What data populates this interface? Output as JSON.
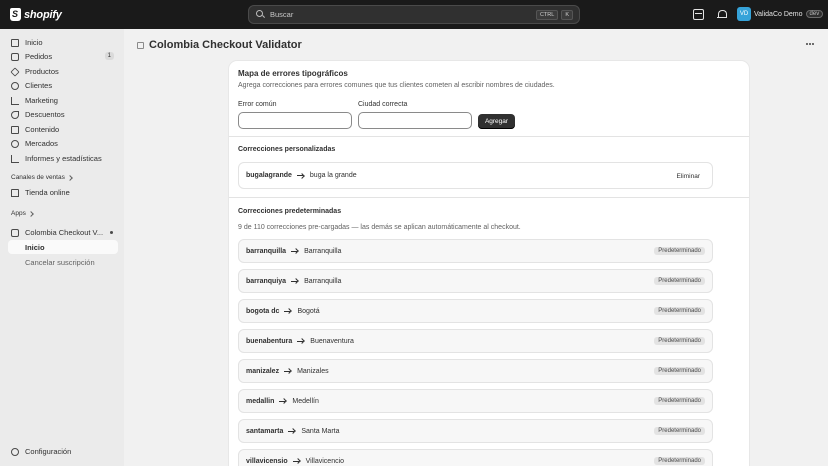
{
  "topbar": {
    "logo_text": "shopify",
    "search_placeholder": "Buscar",
    "shortcut_keys": [
      "CTRL",
      "K"
    ],
    "account_initials": "VD",
    "account_name": "ValidaCo Demo",
    "account_badge": "dev"
  },
  "sidebar": {
    "items": [
      {
        "label": "Inicio",
        "icon": "home-icon"
      },
      {
        "label": "Pedidos",
        "icon": "orders-icon",
        "count": "1"
      },
      {
        "label": "Productos",
        "icon": "tag-icon"
      },
      {
        "label": "Clientes",
        "icon": "person-icon"
      },
      {
        "label": "Marketing",
        "icon": "target-icon"
      },
      {
        "label": "Descuentos",
        "icon": "discount-icon"
      },
      {
        "label": "Contenido",
        "icon": "content-icon"
      },
      {
        "label": "Mercados",
        "icon": "globe-icon"
      },
      {
        "label": "Informes y estadísticas",
        "icon": "chart-icon"
      }
    ],
    "sales_channels_label": "Canales de ventas",
    "online_store_label": "Tienda online",
    "apps_label": "Apps",
    "app_name": "Colombia Checkout V...",
    "app_sub_home": "Inicio",
    "app_sub_cancel": "Cancelar suscripción",
    "settings_label": "Configuración"
  },
  "page": {
    "title": "Colombia Checkout Validator"
  },
  "card": {
    "title": "Mapa de errores tipográficos",
    "subtitle": "Agrega correcciones para errores comunes que tus clientes cometen al escribir nombres de ciudades.",
    "error_label": "Error común",
    "error_value": "",
    "city_label": "Ciudad correcta",
    "city_value": "",
    "add_button": "Agregar",
    "custom_title": "Correcciones personalizadas",
    "custom_rows": [
      {
        "from": "bugalagrande",
        "to": "buga la grande",
        "action": "Eliminar"
      }
    ],
    "default_title": "Correcciones predeterminadas",
    "default_desc": "9 de 110 correcciones pre-cargadas — las demás se aplican automáticamente al checkout.",
    "default_tag": "Predeterminado",
    "default_rows": [
      {
        "from": "barranquilla",
        "to": "Barranquilla"
      },
      {
        "from": "barranquiya",
        "to": "Barranquilla"
      },
      {
        "from": "bogota dc",
        "to": "Bogotá"
      },
      {
        "from": "buenabentura",
        "to": "Buenaventura"
      },
      {
        "from": "manizalez",
        "to": "Manizales"
      },
      {
        "from": "medallin",
        "to": "Medellín"
      },
      {
        "from": "santamarta",
        "to": "Santa Marta"
      },
      {
        "from": "villavicensio",
        "to": "Villavicencio"
      }
    ]
  }
}
